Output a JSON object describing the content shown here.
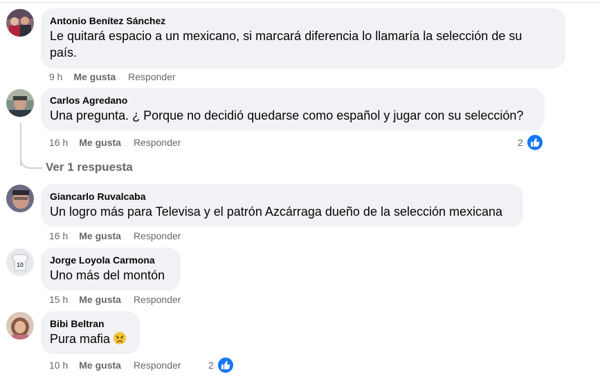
{
  "comments": [
    {
      "author": "Antonio Benítez Sánchez",
      "text_line1": "Le quitará espacio a un mexicano, si marcará diferencia lo llamaría la selección de su",
      "text_line2": "país.",
      "time": "9 h",
      "like": "Me gusta",
      "reply": "Responder"
    },
    {
      "author": "Carlos Agredano",
      "text": "Una pregunta. ¿ Porque no decidió quedarse como español y jugar con su selección?",
      "time": "16 h",
      "like": "Me gusta",
      "reply": "Responder",
      "reaction_count": "2",
      "view_replies": "Ver 1 respuesta"
    },
    {
      "author": "Giancarlo Ruvalcaba",
      "text": "Un logro más para Televisa y el patrón Azcárraga dueño de la selección mexicana",
      "time": "16 h",
      "like": "Me gusta",
      "reply": "Responder"
    },
    {
      "author": "Jorge Loyola Carmona",
      "text": "Uno más del montón",
      "time": "15 h",
      "like": "Me gusta",
      "reply": "Responder"
    },
    {
      "author": "Bibi Beltran",
      "text": "Pura mafia",
      "time": "10 h",
      "like": "Me gusta",
      "reply": "Responder",
      "reaction_count": "2"
    }
  ],
  "colors": {
    "bubble": "#f0f2f5",
    "meta_text": "#65676b",
    "like_blue": "#1877f2"
  }
}
